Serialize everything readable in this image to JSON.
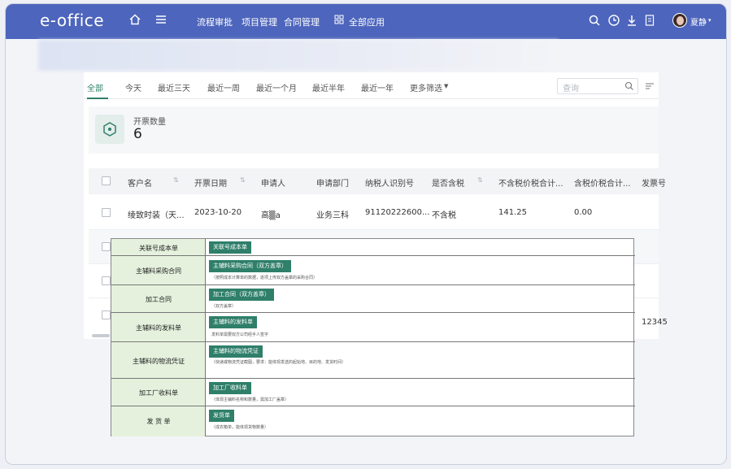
{
  "app": {
    "logo": "e-office",
    "nav_links": [
      "流程审批",
      "项目管理",
      "合同管理",
      "全部应用"
    ],
    "user": "夏静"
  },
  "filter": {
    "tabs": [
      "全部",
      "今天",
      "最近三天",
      "最近一周",
      "最近一个月",
      "最近半年",
      "最近一年",
      "更多筛选"
    ],
    "active_tab": "全部",
    "search_placeholder": "查询"
  },
  "stat": {
    "label": "开票数量",
    "value": "6"
  },
  "table": {
    "headers": [
      "客户名",
      "开票日期",
      "申请人",
      "申请部门",
      "纳税人识别号",
      "是否含税",
      "不含税价税合计...",
      "含税价税合计...",
      "发票号"
    ],
    "rows": [
      {
        "customer": "绫致时装（天...",
        "date": "2023-10-20",
        "applicant": "高▒a",
        "dept": "业务三科",
        "taxid": "91120222600...",
        "tax_included": "不含税",
        "amount_excl": "141.25",
        "amount_incl": "0.00"
      }
    ],
    "partial_cell": "12345"
  },
  "overlay": {
    "rows": [
      {
        "left": "关联号成本单",
        "tag": "关联号成本单",
        "sub": ""
      },
      {
        "left": "主辅料采购合同",
        "tag": "主辅料采购合同（双方盖章）",
        "sub": "（按照成本计算单的数据，逐项上传双方盖章的采购合同）"
      },
      {
        "left": "加工合同",
        "tag": "加工合同（双方盖章）",
        "sub": "（双方盖章）"
      },
      {
        "left": "主辅料的发料单",
        "tag": "主辅料的发料单",
        "sub": "发料单需要双方公司经手人签字"
      },
      {
        "left": "主辅料的物流凭证",
        "tag": "主辅料的物流凭证",
        "sub": "（快递或物流凭证截图，要求：能体现发送的起始地、目的地、发货时间）"
      },
      {
        "left": "加工厂收料单",
        "tag": "加工厂收料单",
        "sub": "（体现主辅料名称和数量，需加工厂盖章）"
      },
      {
        "left": "发 货 单",
        "tag": "发货单",
        "sub": "（成衣箱单，能体现货物数量）"
      }
    ]
  },
  "colors": {
    "topbar": "#4d65bc",
    "accent": "#2f7f6a",
    "overlay_left": "#e5f1dd"
  }
}
